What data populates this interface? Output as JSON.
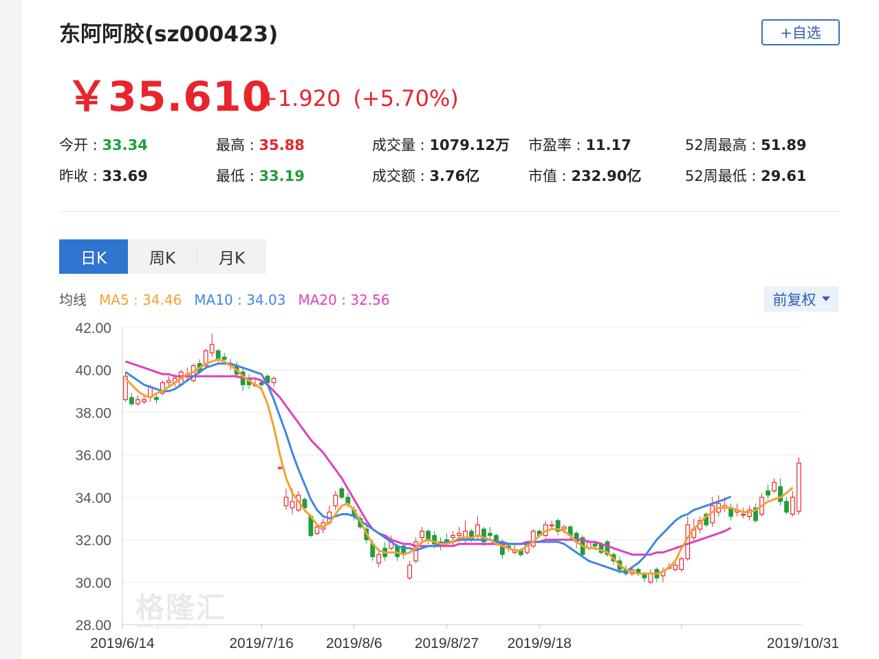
{
  "header": {
    "title": "东阿阿胶(sz000423)",
    "watch_button": "+自选",
    "price": "￥35.610",
    "change": "+1.920",
    "change_pct": "(+5.70%)"
  },
  "stats": [
    {
      "label": "今开 : ",
      "value": "33.34",
      "tone": "down"
    },
    {
      "label": "最高 : ",
      "value": "35.88",
      "tone": "up"
    },
    {
      "label": "成交量 : ",
      "value": "1079.12万",
      "tone": "neutral"
    },
    {
      "label": "市盈率 : ",
      "value": "11.17",
      "tone": "neutral"
    },
    {
      "label": "52周最高 : ",
      "value": "51.89",
      "tone": "neutral"
    },
    {
      "label": "昨收 : ",
      "value": "33.69",
      "tone": "neutral"
    },
    {
      "label": "最低 : ",
      "value": "33.19",
      "tone": "down"
    },
    {
      "label": "成交额 : ",
      "value": "3.76亿",
      "tone": "neutral"
    },
    {
      "label": "市值 : ",
      "value": "232.90亿",
      "tone": "neutral"
    },
    {
      "label": "52周最低 : ",
      "value": "29.61",
      "tone": "neutral"
    }
  ],
  "tabs": [
    {
      "label": "日K",
      "active": true
    },
    {
      "label": "周K",
      "active": false
    },
    {
      "label": "月K",
      "active": false
    }
  ],
  "ma_legend": {
    "label": "均线",
    "ma5": "MA5 : 34.46",
    "ma10": "MA10 : 34.03",
    "ma20": "MA20 : 32.56"
  },
  "adjust_dropdown": "前复权",
  "watermark": {
    "text": "格隆汇",
    "sub": "www.gelonghui.com"
  },
  "colors": {
    "up": "#e8242c",
    "down": "#1e9e3a",
    "ma5": "#f5a031",
    "ma10": "#3f86e0",
    "ma20": "#dd3fbe",
    "accent": "#2f74d0"
  },
  "chart_data": {
    "type": "candlestick",
    "y_ticks": [
      "42.00",
      "40.00",
      "38.00",
      "36.00",
      "34.00",
      "32.00",
      "30.00",
      "28.00"
    ],
    "ylim": [
      28,
      42
    ],
    "x_ticks": [
      {
        "label": "2019/6/14",
        "index": 0
      },
      {
        "label": "2019/7/16",
        "index": 22
      },
      {
        "label": "2019/8/6",
        "index": 37
      },
      {
        "label": "2019/8/27",
        "index": 52
      },
      {
        "label": "2019/9/18",
        "index": 67
      },
      {
        "label": "2019/10/31",
        "index": 90
      }
    ],
    "candles": [
      [
        38.6,
        39.7,
        39.9,
        38.5
      ],
      [
        38.7,
        38.4,
        38.9,
        38.3
      ],
      [
        38.4,
        38.6,
        38.8,
        38.3
      ],
      [
        38.5,
        38.6,
        38.8,
        38.4
      ],
      [
        38.7,
        39.2,
        39.3,
        38.5
      ],
      [
        38.7,
        38.6,
        38.9,
        38.4
      ],
      [
        38.9,
        39.4,
        39.5,
        38.8
      ],
      [
        39.4,
        39.5,
        39.7,
        39.2
      ],
      [
        39.4,
        39.6,
        39.8,
        39.2
      ],
      [
        39.3,
        39.9,
        40.0,
        39.2
      ],
      [
        39.7,
        39.8,
        40.1,
        39.5
      ],
      [
        39.5,
        40.2,
        40.3,
        39.4
      ],
      [
        40.3,
        39.9,
        40.5,
        39.8
      ],
      [
        40.2,
        40.9,
        41.0,
        40.1
      ],
      [
        40.8,
        41.2,
        41.7,
        40.6
      ],
      [
        40.9,
        40.5,
        41.0,
        40.3
      ],
      [
        40.6,
        40.5,
        40.8,
        40.4
      ],
      [
        40.2,
        40.3,
        40.5,
        40.0
      ],
      [
        40.2,
        39.8,
        40.4,
        39.6
      ],
      [
        39.9,
        39.3,
        40.1,
        39.0
      ],
      [
        39.6,
        39.3,
        39.8,
        39.1
      ],
      [
        39.3,
        39.3,
        39.6,
        39.2
      ],
      [
        39.4,
        39.3,
        39.5,
        39.1
      ],
      [
        39.7,
        39.4,
        39.8,
        39.2
      ],
      [
        39.4,
        39.6,
        39.7,
        39.2
      ],
      [
        35.4,
        35.4,
        35.5,
        35.3
      ],
      [
        33.6,
        34.0,
        34.4,
        33.4
      ],
      [
        33.5,
        33.8,
        34.4,
        33.2
      ],
      [
        33.4,
        34.1,
        34.3,
        33.3
      ],
      [
        33.9,
        33.5,
        34.0,
        33.3
      ],
      [
        33.1,
        32.2,
        33.2,
        32.1
      ],
      [
        32.3,
        32.6,
        32.7,
        32.2
      ],
      [
        32.5,
        32.8,
        33.0,
        32.3
      ],
      [
        32.8,
        33.3,
        33.6,
        32.7
      ],
      [
        33.6,
        34.1,
        34.3,
        33.4
      ],
      [
        34.4,
        34.0,
        34.5,
        33.9
      ],
      [
        34.0,
        33.7,
        34.2,
        33.5
      ],
      [
        33.4,
        33.1,
        33.6,
        32.9
      ],
      [
        33.0,
        32.6,
        33.2,
        32.5
      ],
      [
        32.5,
        32.0,
        32.8,
        31.8
      ],
      [
        31.8,
        31.2,
        32.0,
        31.0
      ],
      [
        30.9,
        31.3,
        31.5,
        30.7
      ],
      [
        31.6,
        31.2,
        31.9,
        31.0
      ],
      [
        31.6,
        32.0,
        32.2,
        31.5
      ],
      [
        31.7,
        31.2,
        31.8,
        31.0
      ],
      [
        31.7,
        31.4,
        31.8,
        31.1
      ],
      [
        30.2,
        30.8,
        31.0,
        30.1
      ],
      [
        31.0,
        31.9,
        32.1,
        30.9
      ],
      [
        32.1,
        32.4,
        32.6,
        31.8
      ],
      [
        32.4,
        32.0,
        32.5,
        31.8
      ],
      [
        32.2,
        31.8,
        32.4,
        31.6
      ],
      [
        31.9,
        31.7,
        32.1,
        31.5
      ],
      [
        32.0,
        31.9,
        32.3,
        31.8
      ],
      [
        32.1,
        32.2,
        32.4,
        31.7
      ],
      [
        32.2,
        32.3,
        32.6,
        31.9
      ],
      [
        32.0,
        32.4,
        32.9,
        31.8
      ],
      [
        32.4,
        32.0,
        32.5,
        31.9
      ],
      [
        32.2,
        32.7,
        33.1,
        32.0
      ],
      [
        32.5,
        31.9,
        32.6,
        31.7
      ],
      [
        32.3,
        32.2,
        32.6,
        32.0
      ],
      [
        32.2,
        31.8,
        32.3,
        31.7
      ],
      [
        31.9,
        31.3,
        32.0,
        31.1
      ],
      [
        31.7,
        31.6,
        31.8,
        31.4
      ],
      [
        31.4,
        31.5,
        31.8,
        31.3
      ],
      [
        31.5,
        31.3,
        31.6,
        31.2
      ],
      [
        31.4,
        31.8,
        31.9,
        31.3
      ],
      [
        31.7,
        32.4,
        32.5,
        31.6
      ],
      [
        32.4,
        32.2,
        32.5,
        32.1
      ],
      [
        32.2,
        32.7,
        32.9,
        32.1
      ],
      [
        32.7,
        32.7,
        32.9,
        32.5
      ],
      [
        32.9,
        32.4,
        33.0,
        32.2
      ],
      [
        32.5,
        32.6,
        32.7,
        32.3
      ],
      [
        32.6,
        32.2,
        32.7,
        32.0
      ],
      [
        32.3,
        31.9,
        32.4,
        31.6
      ],
      [
        32.1,
        31.3,
        32.2,
        31.2
      ],
      [
        31.6,
        31.9,
        32.0,
        31.5
      ],
      [
        31.8,
        31.7,
        31.9,
        31.5
      ],
      [
        31.8,
        31.4,
        31.9,
        31.3
      ],
      [
        31.9,
        31.3,
        32.0,
        31.2
      ],
      [
        31.3,
        31.0,
        31.4,
        30.8
      ],
      [
        31.0,
        30.6,
        31.2,
        30.4
      ],
      [
        30.6,
        30.4,
        30.8,
        30.3
      ],
      [
        30.4,
        30.6,
        30.7,
        30.3
      ],
      [
        30.6,
        30.4,
        30.7,
        30.3
      ],
      [
        30.4,
        30.2,
        30.5,
        30.0
      ],
      [
        30.0,
        30.4,
        30.6,
        29.9
      ],
      [
        30.6,
        30.2,
        30.7,
        30.0
      ],
      [
        30.3,
        30.5,
        30.7,
        30.0
      ],
      [
        30.7,
        30.7,
        30.9,
        30.6
      ],
      [
        30.6,
        30.8,
        31.0,
        30.5
      ],
      [
        30.6,
        31.1,
        31.2,
        30.5
      ],
      [
        31.1,
        32.7,
        33.1,
        31.0
      ],
      [
        32.1,
        32.5,
        33.0,
        31.9
      ],
      [
        32.5,
        32.9,
        33.1,
        32.3
      ],
      [
        33.2,
        32.7,
        33.3,
        32.6
      ],
      [
        32.8,
        33.6,
        34.0,
        32.6
      ],
      [
        33.3,
        33.7,
        34.1,
        33.1
      ],
      [
        33.5,
        33.6,
        34.0,
        33.3
      ],
      [
        33.5,
        33.1,
        33.7,
        32.9
      ],
      [
        33.3,
        33.4,
        33.7,
        33.1
      ],
      [
        33.2,
        33.2,
        33.5,
        33.0
      ],
      [
        33.1,
        33.4,
        33.6,
        32.9
      ],
      [
        33.5,
        32.9,
        33.7,
        32.8
      ],
      [
        33.2,
        34.0,
        34.2,
        33.1
      ],
      [
        34.3,
        34.1,
        34.6,
        33.9
      ],
      [
        34.3,
        34.7,
        34.9,
        34.2
      ],
      [
        34.5,
        33.8,
        34.9,
        33.6
      ],
      [
        33.8,
        33.3,
        34.0,
        33.2
      ],
      [
        33.2,
        34.0,
        34.3,
        33.1
      ],
      [
        33.34,
        35.61,
        35.88,
        33.19
      ]
    ],
    "ma5": [
      39.6,
      39.3,
      39.0,
      38.8,
      38.7,
      38.9,
      39.0,
      39.2,
      39.4,
      39.6,
      39.8,
      39.9,
      40.1,
      40.3,
      40.4,
      40.5,
      40.4,
      40.2,
      40.0,
      39.7,
      39.5,
      39.3,
      39.1,
      38.4,
      37.3,
      36.0,
      34.9,
      34.2,
      33.8,
      33.4,
      33.1,
      32.7,
      32.6,
      32.8,
      33.2,
      33.6,
      33.7,
      33.4,
      32.9,
      32.3,
      31.8,
      31.5,
      31.4,
      31.4,
      31.4,
      31.3,
      31.4,
      31.6,
      31.9,
      32.0,
      31.9,
      31.8,
      31.8,
      31.9,
      32.1,
      32.1,
      32.1,
      32.2,
      32.1,
      32.0,
      31.8,
      31.7,
      31.6,
      31.5,
      31.5,
      31.7,
      31.9,
      32.2,
      32.4,
      32.5,
      32.5,
      32.4,
      32.2,
      31.9,
      31.7,
      31.6,
      31.6,
      31.5,
      31.4,
      31.1,
      30.8,
      30.6,
      30.5,
      30.4,
      30.4,
      30.4,
      30.4,
      30.5,
      30.7,
      31.0,
      31.6,
      32.1,
      32.5,
      32.8,
      33.1,
      33.3,
      33.5,
      33.5,
      33.5,
      33.4,
      33.3,
      33.3,
      33.4,
      33.6,
      33.8,
      33.9,
      34.0,
      34.2,
      34.46
    ],
    "ma10": [
      39.9,
      39.7,
      39.5,
      39.3,
      39.2,
      39.1,
      39.0,
      39.0,
      39.1,
      39.3,
      39.5,
      39.7,
      39.9,
      40.1,
      40.2,
      40.3,
      40.3,
      40.3,
      40.2,
      40.1,
      40.0,
      39.9,
      39.8,
      39.3,
      38.6,
      37.8,
      37.0,
      36.1,
      35.3,
      34.6,
      33.9,
      33.4,
      33.1,
      33.0,
      33.1,
      33.2,
      33.2,
      33.1,
      32.9,
      32.7,
      32.5,
      32.3,
      32.1,
      31.9,
      31.7,
      31.6,
      31.6,
      31.5,
      31.6,
      31.7,
      31.7,
      31.8,
      31.9,
      31.9,
      32.0,
      32.0,
      32.0,
      32.0,
      32.0,
      32.0,
      31.9,
      31.9,
      31.8,
      31.8,
      31.8,
      31.8,
      31.9,
      31.9,
      31.9,
      31.9,
      31.9,
      31.8,
      31.6,
      31.4,
      31.2,
      31.0,
      30.9,
      30.8,
      30.7,
      30.6,
      30.5,
      30.5,
      30.7,
      30.9,
      31.2,
      31.6,
      32.0,
      32.3,
      32.6,
      32.9,
      33.1,
      33.2,
      33.4,
      33.5,
      33.6,
      33.7,
      33.8,
      33.9,
      34.03
    ],
    "ma20": [
      40.4,
      40.3,
      40.2,
      40.1,
      40.0,
      39.9,
      39.8,
      39.8,
      39.7,
      39.7,
      39.7,
      39.7,
      39.7,
      39.7,
      39.7,
      39.7,
      39.7,
      39.7,
      39.7,
      39.6,
      39.6,
      39.6,
      39.5,
      39.3,
      39.0,
      38.7,
      38.3,
      37.9,
      37.5,
      37.1,
      36.7,
      36.4,
      36.1,
      35.7,
      35.3,
      34.9,
      34.4,
      33.9,
      33.4,
      32.9,
      32.5,
      32.3,
      32.2,
      32.0,
      31.9,
      31.8,
      31.8,
      31.7,
      31.7,
      31.7,
      31.7,
      31.7,
      31.7,
      31.7,
      31.8,
      31.8,
      31.8,
      31.8,
      31.8,
      31.8,
      31.8,
      31.8,
      31.8,
      31.8,
      31.8,
      31.9,
      31.9,
      31.9,
      32.0,
      32.0,
      32.0,
      32.0,
      32.0,
      32.0,
      32.0,
      31.9,
      31.9,
      31.8,
      31.7,
      31.6,
      31.5,
      31.4,
      31.3,
      31.3,
      31.3,
      31.3,
      31.4,
      31.4,
      31.5,
      31.6,
      31.7,
      31.8,
      31.9,
      32.0,
      32.1,
      32.2,
      32.3,
      32.4,
      32.56
    ]
  }
}
